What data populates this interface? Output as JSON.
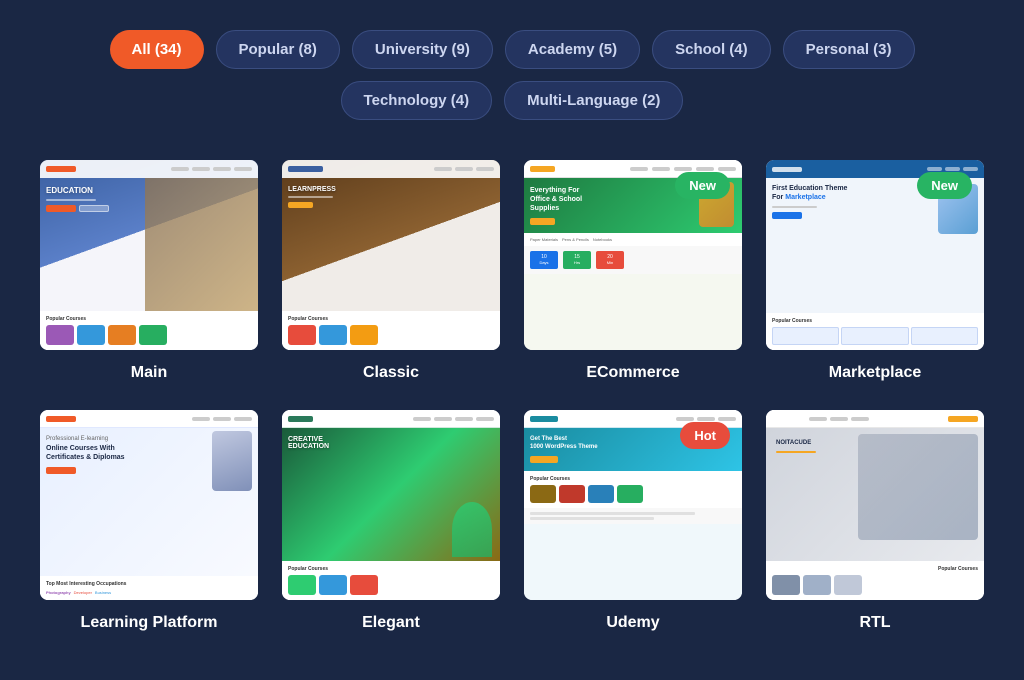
{
  "filters": {
    "row1": [
      {
        "label": "All (34)",
        "active": true,
        "id": "all"
      },
      {
        "label": "Popular (8)",
        "active": false,
        "id": "popular"
      },
      {
        "label": "University (9)",
        "active": false,
        "id": "university"
      },
      {
        "label": "Academy (5)",
        "active": false,
        "id": "academy"
      },
      {
        "label": "School (4)",
        "active": false,
        "id": "school"
      },
      {
        "label": "Personal (3)",
        "active": false,
        "id": "personal"
      }
    ],
    "row2": [
      {
        "label": "Technology (4)",
        "active": false,
        "id": "technology"
      },
      {
        "label": "Multi-Language (2)",
        "active": false,
        "id": "multilang"
      }
    ]
  },
  "cards": [
    {
      "id": "main",
      "label": "Main",
      "badge": null,
      "theme": "main"
    },
    {
      "id": "classic",
      "label": "Classic",
      "badge": null,
      "theme": "classic"
    },
    {
      "id": "ecommerce",
      "label": "ECommerce",
      "badge": {
        "text": "New",
        "type": "new"
      },
      "theme": "ecommerce"
    },
    {
      "id": "marketplace",
      "label": "Marketplace",
      "badge": {
        "text": "New",
        "type": "new"
      },
      "theme": "marketplace"
    },
    {
      "id": "learning-platform",
      "label": "Learning Platform",
      "badge": null,
      "theme": "learning"
    },
    {
      "id": "elegant",
      "label": "Elegant",
      "badge": null,
      "theme": "elegant"
    },
    {
      "id": "udemy",
      "label": "Udemy",
      "badge": {
        "text": "Hot",
        "type": "hot"
      },
      "theme": "udemy"
    },
    {
      "id": "rtl",
      "label": "RTL",
      "badge": null,
      "theme": "rtl"
    }
  ],
  "badge_labels": {
    "new": "New",
    "hot": "Hot"
  }
}
